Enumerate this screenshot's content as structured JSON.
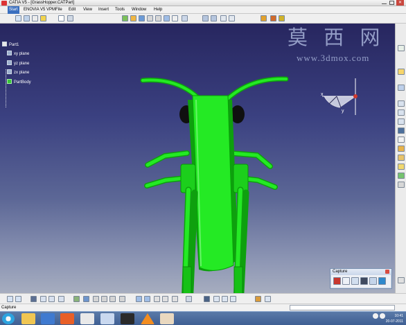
{
  "title_bar": {
    "title": "CATIA V5 - [GrassHopper.CATPart]"
  },
  "menu": [
    "Start",
    "ENOVIA V5 VPM",
    "File",
    "Edit",
    "View",
    "Insert",
    "Tools",
    "Window",
    "Help"
  ],
  "tree": {
    "root": "Part1",
    "items": [
      "xy plane",
      "yz plane",
      "zx plane",
      "PartBody"
    ]
  },
  "watermark": {
    "chars": "莫 西 网",
    "url": "www.3dmox.com"
  },
  "compass": {
    "x": "x",
    "y": "y"
  },
  "capture": {
    "title": "Capture"
  },
  "status": {
    "text": "Capture"
  },
  "taskbar": {
    "time": "10:41",
    "date": "20-07-2011"
  },
  "colors": {
    "viewport_top": "#27265f",
    "viewport_bottom": "#a6adbf",
    "model_green": "#24ea24",
    "model_dark": "#0ea00e",
    "tree_text": "#ffffff",
    "watermark": "#aebadf"
  },
  "icons": [
    "start-icon",
    "save-icon",
    "print-icon",
    "cut-icon",
    "undo-icon",
    "fly-icon",
    "pan-icon",
    "rotate-icon",
    "zoom-in-icon",
    "zoom-out-icon",
    "view-icon",
    "shading-icon",
    "record-icon",
    "pointer-icon",
    "capture-image-icon",
    "movie-icon",
    "settings-icon",
    "taskbar-folder-icon",
    "taskbar-media-icon",
    "taskbar-firefox-icon",
    "taskbar-chrome-icon",
    "taskbar-search-icon",
    "taskbar-catia-icon",
    "taskbar-vlc-icon",
    "taskbar-app-icon"
  ]
}
